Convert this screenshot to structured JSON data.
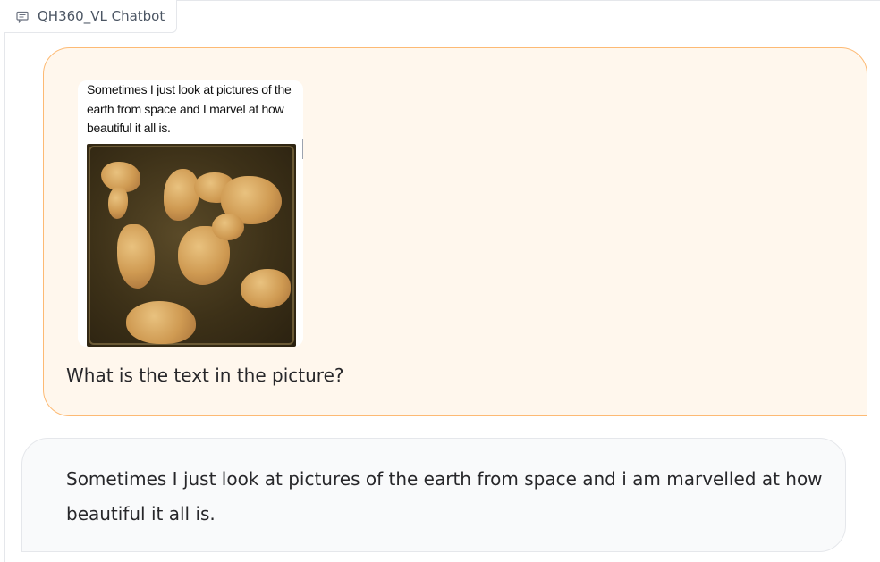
{
  "chatbot": {
    "label": "QH360_VL Chatbot",
    "label_icon": "chat-icon"
  },
  "messages": [
    {
      "role": "user",
      "image": {
        "caption": "Sometimes I just look at pictures of the earth from space and I marvel at how beautiful it all is.",
        "description_icon": "image"
      },
      "text": "What is the text in the picture?"
    },
    {
      "role": "bot",
      "text": "Sometimes I just look at pictures of the earth from space and i am marvelled at how beautiful it all is."
    }
  ],
  "colors": {
    "user_bubble_bg": "#fff7ed",
    "user_bubble_border": "#fdba74",
    "bot_bubble_bg": "#f9fafb",
    "bot_bubble_border": "#e5e7eb"
  }
}
